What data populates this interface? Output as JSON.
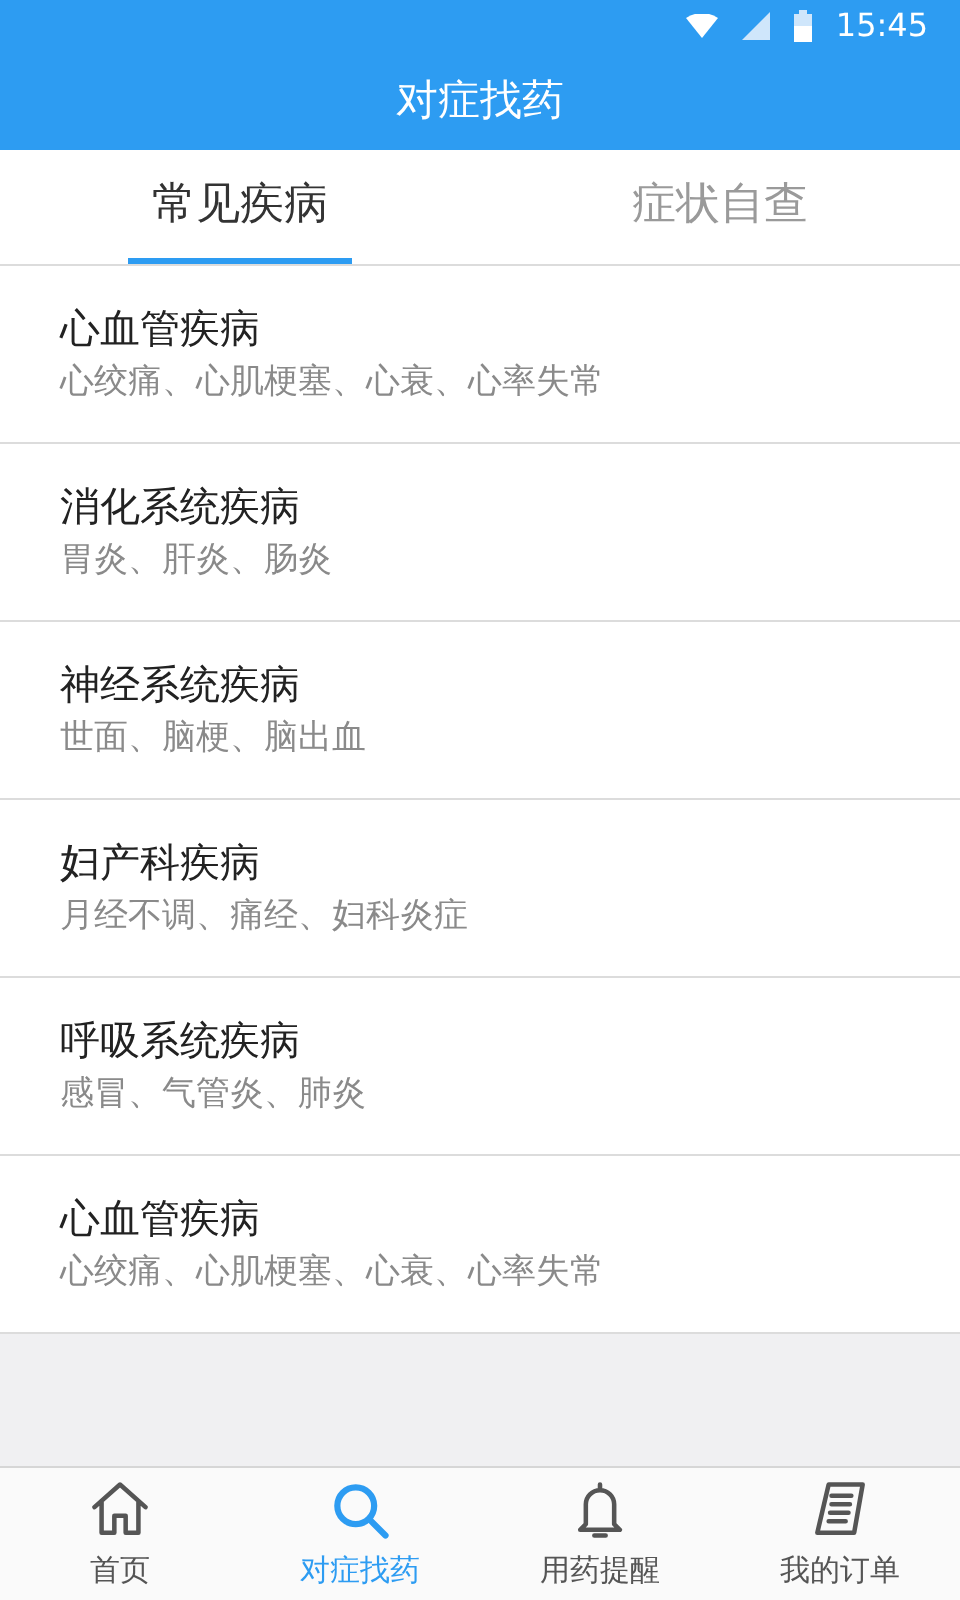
{
  "status_bar": {
    "time": "15:45"
  },
  "header": {
    "title": "对症找药"
  },
  "tabs": [
    {
      "label": "常见疾病",
      "selected": true
    },
    {
      "label": "症状自查",
      "selected": false
    }
  ],
  "diseases": [
    {
      "name": "心血管疾病",
      "symptoms": "心绞痛、心肌梗塞、心衰、心率失常"
    },
    {
      "name": "消化系统疾病",
      "symptoms": "胃炎、肝炎、肠炎"
    },
    {
      "name": "神经系统疾病",
      "symptoms": "世面、脑梗、脑出血"
    },
    {
      "name": "妇产科疾病",
      "symptoms": "月经不调、痛经、妇科炎症"
    },
    {
      "name": "呼吸系统疾病",
      "symptoms": "感冒、气管炎、肺炎"
    },
    {
      "name": "心血管疾病",
      "symptoms": "心绞痛、心肌梗塞、心衰、心率失常"
    }
  ],
  "bottom_nav": [
    {
      "label": "首页",
      "kind": "home",
      "selected": false
    },
    {
      "label": "对症找药",
      "kind": "search",
      "selected": true
    },
    {
      "label": "用药提醒",
      "kind": "bell",
      "selected": false
    },
    {
      "label": "我的订单",
      "kind": "order",
      "selected": false
    }
  ]
}
